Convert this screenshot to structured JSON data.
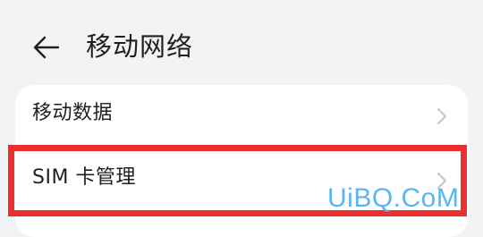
{
  "header": {
    "back_icon": "back-arrow-icon",
    "title": "移动网络"
  },
  "settings": {
    "items": [
      {
        "label": "移动数据",
        "icon": "chevron-right-icon"
      },
      {
        "label": "SIM 卡管理",
        "icon": "chevron-right-icon"
      }
    ]
  },
  "highlight": {
    "color": "#e8312f"
  },
  "watermark": {
    "text": "UiBQ.CoM",
    "color": "#5ab5f0"
  }
}
